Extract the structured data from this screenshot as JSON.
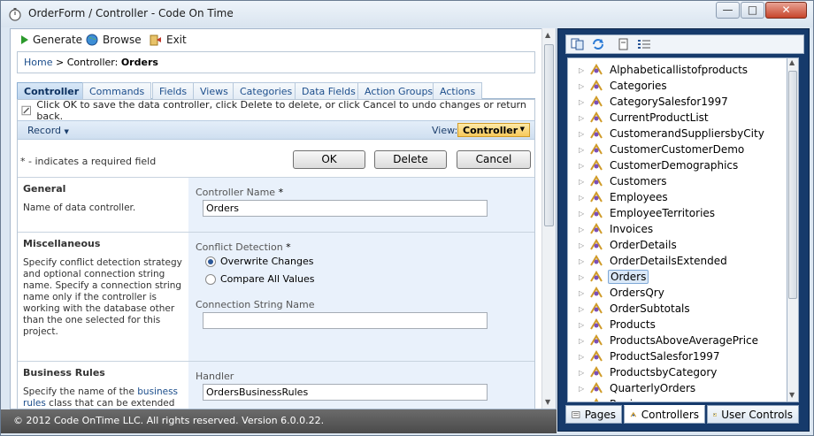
{
  "window": {
    "title": "OrderForm / Controller - Code On Time",
    "minimize": "—",
    "maximize": "□",
    "close": "✕"
  },
  "toolbar": {
    "generate": "Generate",
    "browse": "Browse",
    "exit": "Exit"
  },
  "breadcrumb": {
    "home": "Home",
    "separator": ">",
    "prefix": "Controller:",
    "current": "Orders"
  },
  "tabs": [
    "Controller",
    "Commands",
    "Fields",
    "Views",
    "Categories",
    "Data Fields",
    "Action Groups",
    "Actions"
  ],
  "form": {
    "hint": "Click OK to save the data controller, click Delete to delete, or click Cancel to undo changes or return back.",
    "record_menu": "Record",
    "view_label": "View:",
    "view_value": "Controller",
    "required_note": "* - indicates a required field",
    "ok": "OK",
    "delete": "Delete",
    "cancel": "Cancel",
    "sections": {
      "general": {
        "title": "General",
        "desc": "Name of data controller.",
        "field_label": "Controller Name",
        "required_mark": "*",
        "value": "Orders"
      },
      "misc": {
        "title": "Miscellaneous",
        "desc": "Specify conflict detection strategy and optional connection string name. Specify a connection string name only if the controller is working with the database other than the one selected for this project.",
        "conflict_label": "Conflict Detection",
        "required_mark": "*",
        "option1": "Overwrite Changes",
        "option2": "Compare All Values",
        "conn_label": "Connection String Name",
        "conn_value": ""
      },
      "rules": {
        "title": "Business Rules",
        "desc_prefix": "Specify the name of the",
        "desc_link": "business rules",
        "desc_suffix": "class that can be extended to",
        "handler_label": "Handler",
        "handler_value": "OrdersBusinessRules"
      }
    }
  },
  "status": "© 2012 Code OnTime LLC. All rights reserved. Version 6.0.0.22.",
  "tree": {
    "items": [
      "Alphabeticallistofproducts",
      "Categories",
      "CategorySalesfor1997",
      "CurrentProductList",
      "CustomerandSuppliersbyCity",
      "CustomerCustomerDemo",
      "CustomerDemographics",
      "Customers",
      "Employees",
      "EmployeeTerritories",
      "Invoices",
      "OrderDetails",
      "OrderDetailsExtended",
      "Orders",
      "OrdersQry",
      "OrderSubtotals",
      "Products",
      "ProductsAboveAveragePrice",
      "ProductSalesfor1997",
      "ProductsbyCategory",
      "QuarterlyOrders",
      "Region"
    ],
    "selected": "Orders"
  },
  "right_tabs": {
    "pages": "Pages",
    "controllers": "Controllers",
    "user_controls": "User Controls"
  },
  "colors": {
    "navy_panel": "#163a6b",
    "view_select": "#f7c95b",
    "status_bar": "#4a4a4a"
  }
}
